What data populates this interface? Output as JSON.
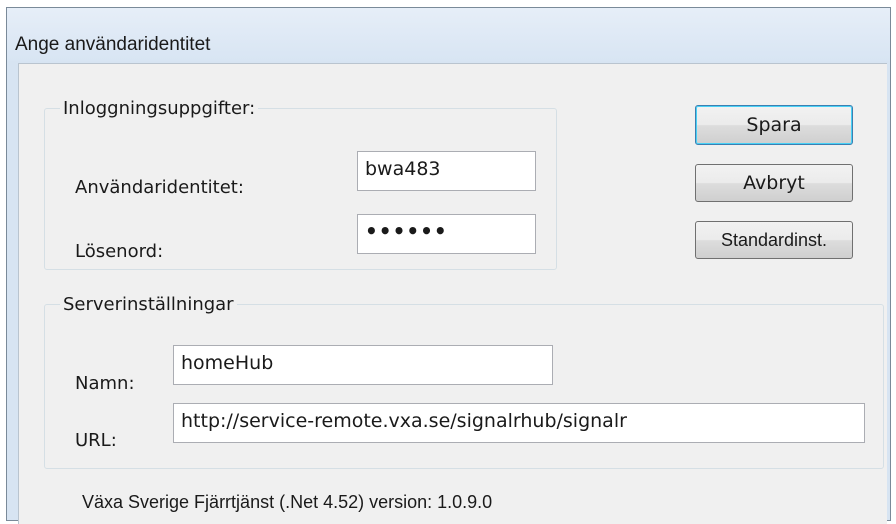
{
  "window": {
    "title": "Ange användaridentitet"
  },
  "login": {
    "legend": "Inloggningsuppgifter:",
    "username_label": "Användaridentitet:",
    "username_value": "bwa483",
    "password_label": "Lösenord:",
    "password_value": "••••••"
  },
  "server": {
    "legend": "Serverinställningar",
    "name_label": "Namn:",
    "name_value": "homeHub",
    "url_label": "URL:",
    "url_value": "http://service-remote.vxa.se/signalrhub/signalr"
  },
  "buttons": {
    "save": "Spara",
    "cancel": "Avbryt",
    "defaults": "Standardinst."
  },
  "footer": {
    "version_text": "Växa Sverige Fjärrtjänst (.Net 4.52) version: 1.0.9.0"
  }
}
